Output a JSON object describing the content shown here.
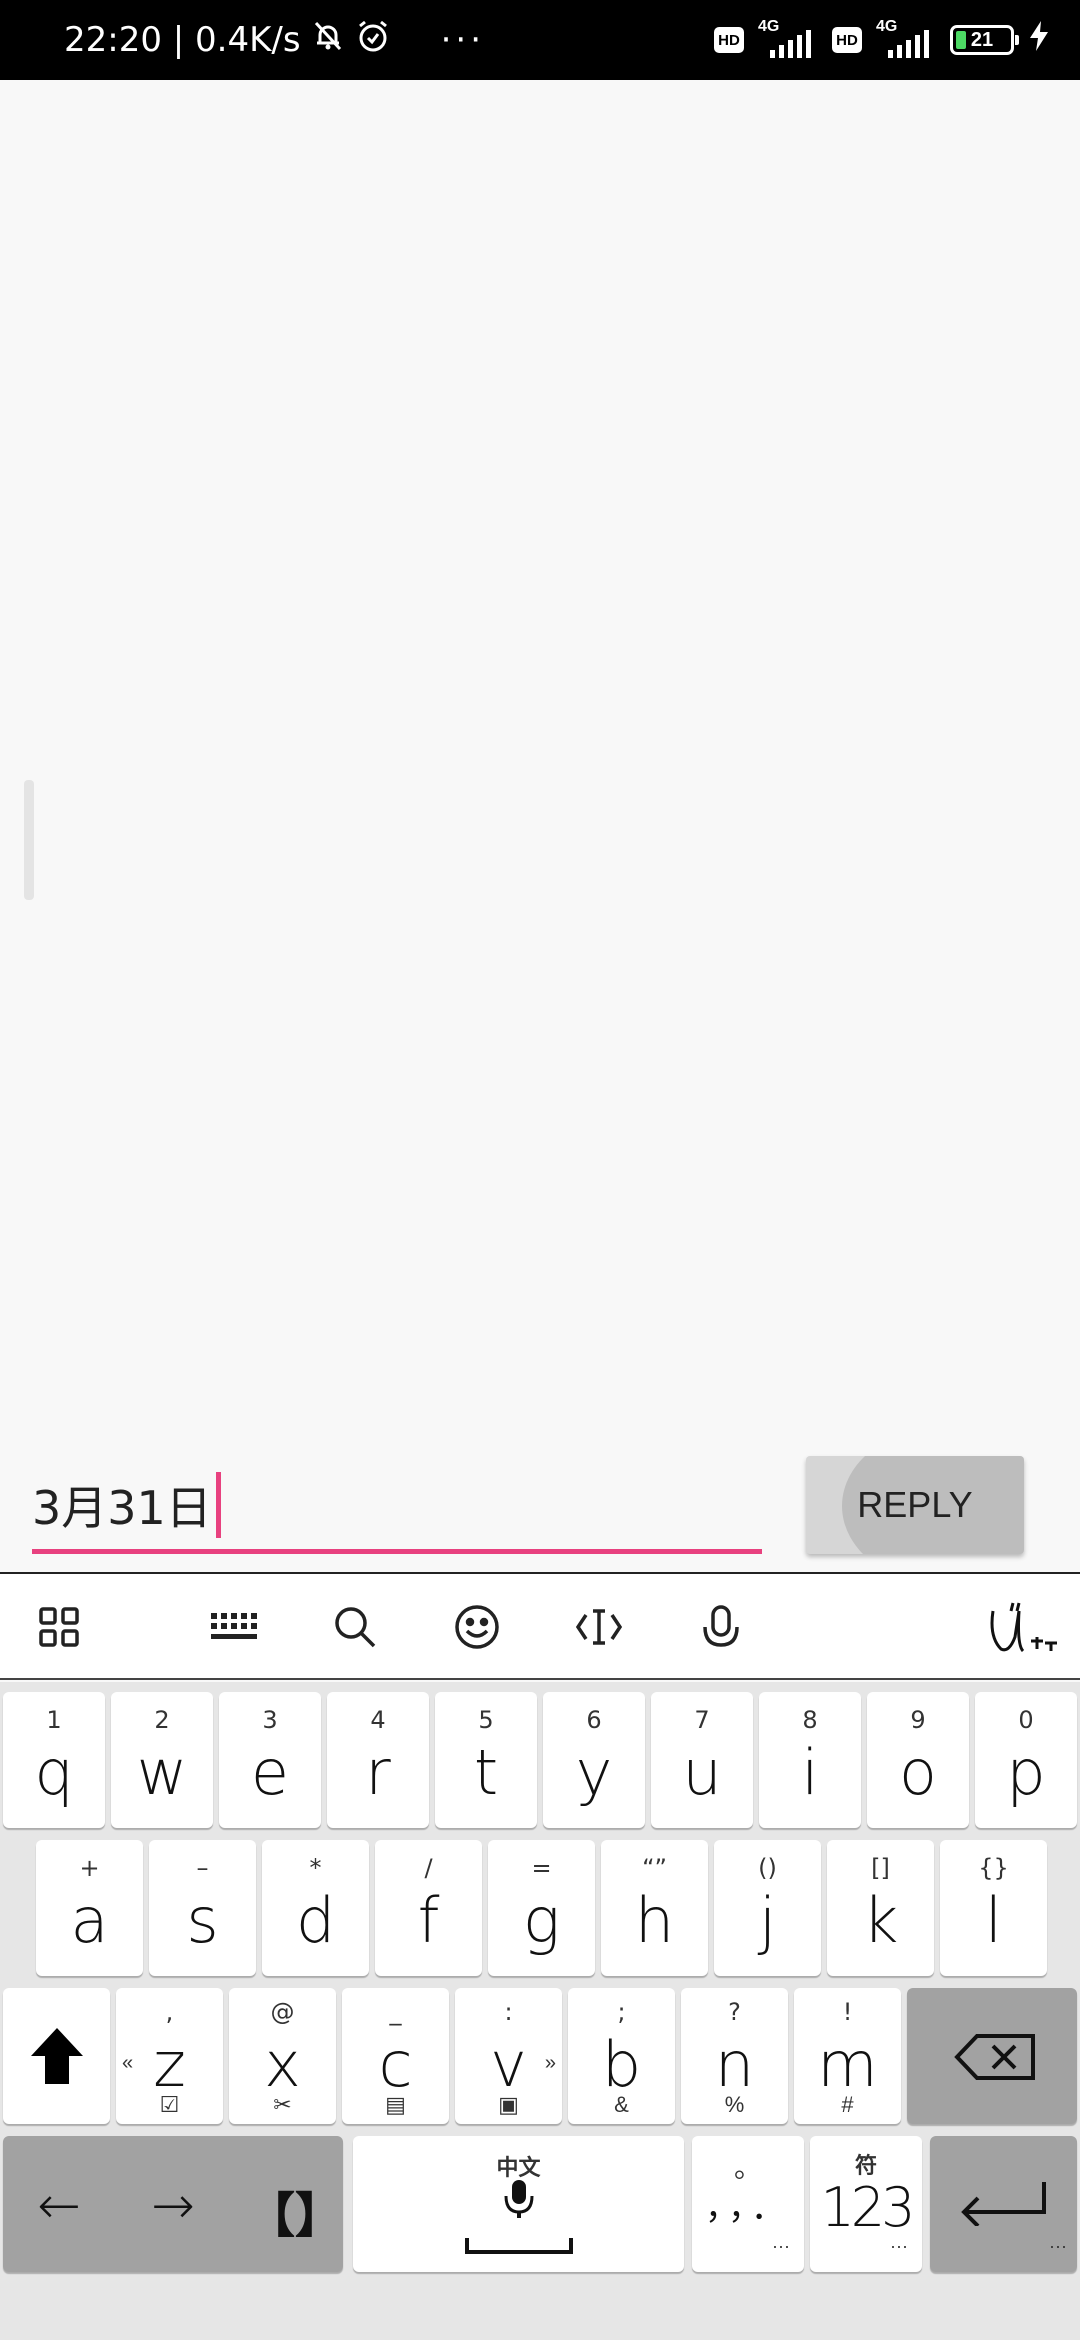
{
  "status_bar": {
    "time_speed": "22:20 | 0.4K/s",
    "dots": "···",
    "sim1_tag": "4G",
    "sim2_tag": "4G",
    "hd_label": "HD",
    "battery": "21",
    "icons": [
      "bell-off-icon",
      "alarm-icon",
      "signal-icon",
      "battery-icon",
      "charging-bolt-icon"
    ]
  },
  "reply": {
    "input_value": "3月31日",
    "button_label": "REPLY",
    "accent_color": "#e8417f"
  },
  "toolbar": {
    "icons": [
      "grid-menu-icon",
      "keyboard-icon",
      "search-icon",
      "emoji-icon",
      "cursor-icon",
      "microphone-icon",
      "handwriting-logo-icon"
    ]
  },
  "keyboard": {
    "row1": [
      {
        "k": "q",
        "n": "1"
      },
      {
        "k": "w",
        "n": "2"
      },
      {
        "k": "e",
        "n": "3"
      },
      {
        "k": "r",
        "n": "4"
      },
      {
        "k": "t",
        "n": "5"
      },
      {
        "k": "y",
        "n": "6"
      },
      {
        "k": "u",
        "n": "7"
      },
      {
        "k": "i",
        "n": "8"
      },
      {
        "k": "o",
        "n": "9"
      },
      {
        "k": "p",
        "n": "0"
      }
    ],
    "row2": [
      {
        "k": "a",
        "n": "+"
      },
      {
        "k": "s",
        "n": "–"
      },
      {
        "k": "d",
        "n": "*"
      },
      {
        "k": "f",
        "n": "/"
      },
      {
        "k": "g",
        "n": "="
      },
      {
        "k": "h",
        "n": "“”"
      },
      {
        "k": "j",
        "n": "()"
      },
      {
        "k": "k",
        "n": "[]"
      },
      {
        "k": "l",
        "n": "{}"
      }
    ],
    "row3": [
      {
        "k": "z",
        "n": ",",
        "b": "☑",
        "l": "«"
      },
      {
        "k": "x",
        "n": "@",
        "b": "✂"
      },
      {
        "k": "c",
        "n": "_",
        "b": "▤"
      },
      {
        "k": "v",
        "n": ":",
        "b": "▣",
        "r": "»"
      },
      {
        "k": "b",
        "n": ";",
        "b": "&"
      },
      {
        "k": "n",
        "n": "?",
        "b": "%"
      },
      {
        "k": "m",
        "n": "!",
        "b": "#"
      }
    ],
    "shift_icon": "shift-arrow-icon",
    "backspace_icon": "backspace-icon",
    "left_arrow": "←",
    "right_arrow": "→",
    "brackets": "【】",
    "space_label": "中文",
    "punct_top": "。",
    "punct_bottom": "，，．",
    "num_top": "符",
    "num_label": "123",
    "enter_icon": "enter-icon",
    "ellipsis": "···"
  }
}
